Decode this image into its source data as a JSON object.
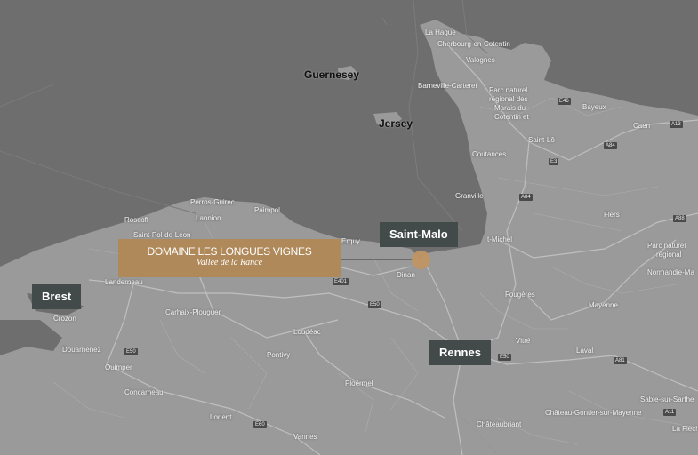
{
  "colors": {
    "sea": "#6e6e6e",
    "land": "#9a9a9a",
    "label_box": "#434a4a",
    "domain_box": "#b0895a",
    "marker": "#bf9563"
  },
  "domain": {
    "title": "DOMAINE LES LONGUES VIGNES",
    "subtitle": "Vallée de la Rance"
  },
  "cities": {
    "saint_malo": "Saint-Malo",
    "brest": "Brest",
    "rennes": "Rennes"
  },
  "islands": {
    "guernesey": "Guernesey",
    "jersey": "Jersey"
  },
  "places": {
    "la_hague": "La Hague",
    "cherbourg": "Cherbourg-en-Cotentin",
    "valognes": "Valognes",
    "barneville": "Barneville-Carteret",
    "parc_marais_1": "Parc naturel",
    "parc_marais_2": "régional des",
    "parc_marais_3": "Marais du",
    "parc_marais_4": "Cotentin et",
    "bayeux": "Bayeux",
    "caen": "Caen",
    "saint_lo": "Saint-Lô",
    "coutances": "Coutances",
    "granville": "Granville",
    "flers": "Flers",
    "parc_normandie_1": "Parc naturel",
    "parc_normandie_2": "régional",
    "parc_normandie_3": "Normandie-Ma",
    "perros": "Perros-Guirec",
    "paimpol": "Paimpol",
    "lannion": "Lannion",
    "roscoff": "Roscoff",
    "saint_pol": "Saint-Pol-de-Léon",
    "erquy": "Erquy",
    "saint_michel": "t-Michel",
    "landerneau": "Landerneau",
    "crozon": "Crozon",
    "carhaix": "Carhaix-Plouguer",
    "dinan": "Dinan",
    "fougeres": "Fougères",
    "mayenne": "Mayenne",
    "vitre": "Vitré",
    "laval": "Laval",
    "loudeac": "Loudéac",
    "pontivy": "Pontivy",
    "ploermel": "Ploërmel",
    "douarnenez": "Douarnenez",
    "quimper": "Quimper",
    "concarneau": "Concarneau",
    "lorient": "Lorient",
    "vannes": "Vannes",
    "chateaubriant": "Châteaubriant",
    "chateau_gontier": "Château-Gontier-sur-Mayenne",
    "sable": "Sable-sur-Sarthe",
    "la_fleche": "La Flèche"
  },
  "roads": {
    "e46": "E46",
    "a84": "A84",
    "e3": "E3",
    "a84b": "A84",
    "a13": "A13",
    "a88": "A88",
    "e401": "E401",
    "e50a": "E50",
    "e50b": "E50",
    "e60": "E60",
    "e50c": "E50",
    "a81": "A81",
    "a11": "A11"
  }
}
